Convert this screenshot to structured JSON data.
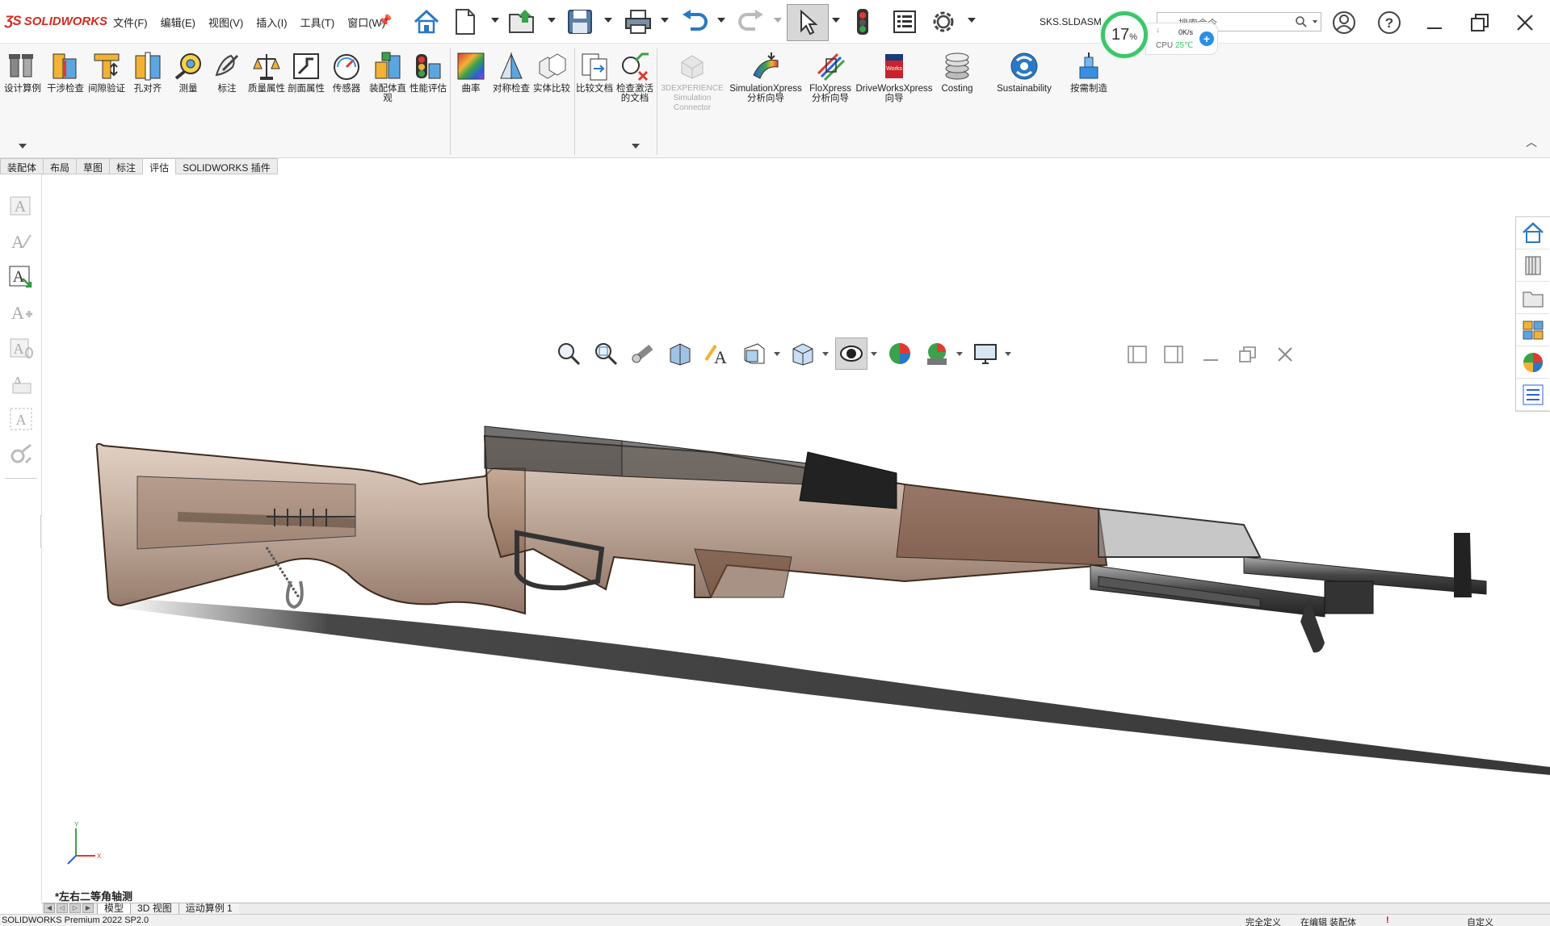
{
  "app": {
    "logo_text": "SOLIDWORKS",
    "document_name": "SKS.SLDASM *",
    "brand_color": "#d52b1e"
  },
  "menus": [
    "文件(F)",
    "编辑(E)",
    "视图(V)",
    "插入(I)",
    "工具(T)",
    "窗口(W)"
  ],
  "cpu_widget": {
    "percent": "17",
    "percent_sign": "%",
    "speed": "0K/s",
    "label": "CPU",
    "temp": "25℃"
  },
  "search": {
    "placeholder": "搜索命令"
  },
  "command_manager": {
    "tools": [
      {
        "label": "设计算例",
        "icon": "design-study-icon"
      },
      {
        "label": "干涉检查",
        "icon": "interference-check-icon"
      },
      {
        "label": "间隙验证",
        "icon": "clearance-verification-icon"
      },
      {
        "label": "孔对齐",
        "icon": "hole-alignment-icon"
      },
      {
        "label": "测量",
        "icon": "measure-icon"
      },
      {
        "label": "标注",
        "icon": "markup-icon"
      },
      {
        "label": "质量属性",
        "icon": "mass-properties-icon"
      },
      {
        "label": "剖面属性",
        "icon": "section-properties-icon"
      },
      {
        "label": "传感器",
        "icon": "sensor-icon"
      },
      {
        "label": "装配体直观",
        "icon": "assembly-visualization-icon"
      },
      {
        "label": "性能评估",
        "icon": "performance-evaluation-icon"
      },
      {
        "label": "曲率",
        "icon": "curvature-icon"
      },
      {
        "label": "对称检查",
        "icon": "symmetry-check-icon"
      },
      {
        "label": "实体比较",
        "icon": "compare-bodies-icon"
      },
      {
        "label": "比较文档",
        "icon": "compare-documents-icon"
      },
      {
        "label": "检查激活的文档",
        "icon": "check-active-document-icon"
      },
      {
        "label": "3DEXPERIENCE Simulation Connector",
        "icon": "3dexperience-icon",
        "disabled": true
      },
      {
        "label": "SimulationXpress 分析向导",
        "icon": "simulationxpress-icon"
      },
      {
        "label": "FloXpress 分析向导",
        "icon": "floxpress-icon"
      },
      {
        "label": "DriveWorksXpress 向导",
        "icon": "driveworksxpress-icon"
      },
      {
        "label": "Costing",
        "icon": "costing-icon"
      },
      {
        "label": "Sustainability",
        "icon": "sustainability-icon"
      },
      {
        "label": "按需制造",
        "icon": "manufacture-on-demand-icon"
      }
    ]
  },
  "tabs": [
    {
      "label": "装配体"
    },
    {
      "label": "布局"
    },
    {
      "label": "草图"
    },
    {
      "label": "标注"
    },
    {
      "label": "评估",
      "active": true
    },
    {
      "label": "SOLIDWORKS 插件"
    }
  ],
  "viewport": {
    "view_name": "*左右二等角轴测",
    "triad": {
      "x": "X",
      "y": "Y"
    }
  },
  "bottom_tabs": [
    {
      "label": "模型",
      "active": true
    },
    {
      "label": "3D 视图"
    },
    {
      "label": "运动算例 1"
    }
  ],
  "status_bar": {
    "product": "SOLIDWORKS Premium 2022 SP2.0",
    "defined": "完全定义",
    "editing": "在编辑 装配体",
    "custom": "自定义"
  }
}
